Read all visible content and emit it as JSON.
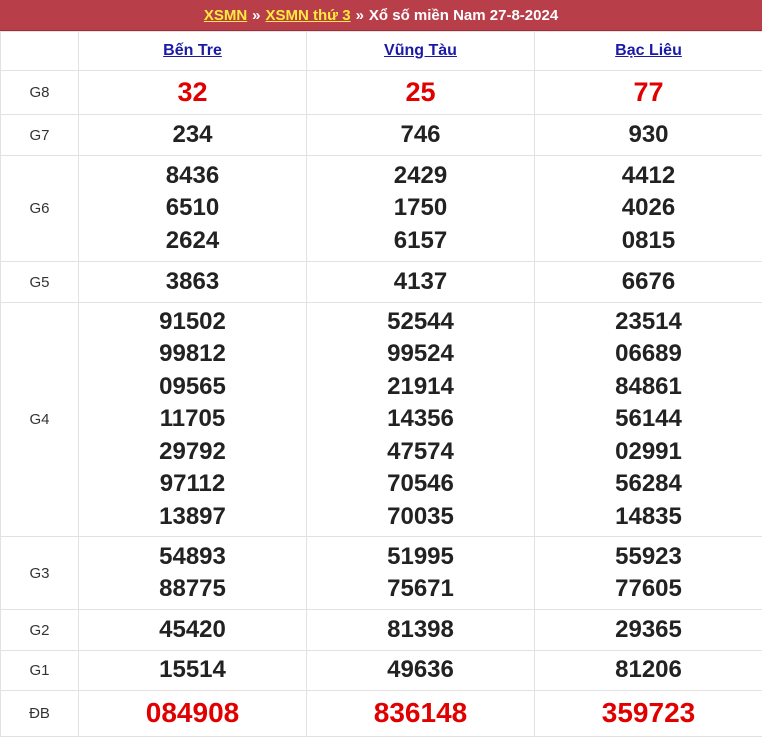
{
  "header": {
    "link1": "XSMN",
    "sep": "»",
    "link2": "XSMN thứ 3",
    "title": "Xổ số miền Nam 27-8-2024"
  },
  "provinces": [
    "Bến Tre",
    "Vũng Tàu",
    "Bạc Liêu"
  ],
  "prizes": {
    "g8": {
      "label": "G8",
      "values": [
        [
          "32"
        ],
        [
          "25"
        ],
        [
          "77"
        ]
      ]
    },
    "g7": {
      "label": "G7",
      "values": [
        [
          "234"
        ],
        [
          "746"
        ],
        [
          "930"
        ]
      ]
    },
    "g6": {
      "label": "G6",
      "values": [
        [
          "8436",
          "6510",
          "2624"
        ],
        [
          "2429",
          "1750",
          "6157"
        ],
        [
          "4412",
          "4026",
          "0815"
        ]
      ]
    },
    "g5": {
      "label": "G5",
      "values": [
        [
          "3863"
        ],
        [
          "4137"
        ],
        [
          "6676"
        ]
      ]
    },
    "g4": {
      "label": "G4",
      "values": [
        [
          "91502",
          "99812",
          "09565",
          "11705",
          "29792",
          "97112",
          "13897"
        ],
        [
          "52544",
          "99524",
          "21914",
          "14356",
          "47574",
          "70546",
          "70035"
        ],
        [
          "23514",
          "06689",
          "84861",
          "56144",
          "02991",
          "56284",
          "14835"
        ]
      ]
    },
    "g3": {
      "label": "G3",
      "values": [
        [
          "54893",
          "88775"
        ],
        [
          "51995",
          "75671"
        ],
        [
          "55923",
          "77605"
        ]
      ]
    },
    "g2": {
      "label": "G2",
      "values": [
        [
          "45420"
        ],
        [
          "81398"
        ],
        [
          "29365"
        ]
      ]
    },
    "g1": {
      "label": "G1",
      "values": [
        [
          "15514"
        ],
        [
          "49636"
        ],
        [
          "81206"
        ]
      ]
    },
    "db": {
      "label": "ĐB",
      "values": [
        [
          "084908"
        ],
        [
          "836148"
        ],
        [
          "359723"
        ]
      ]
    }
  },
  "colors": {
    "header_bg": "#b83f4a",
    "link_yellow": "#ffeb3b",
    "province_blue": "#1a1aa6",
    "prize_red": "#e00000"
  }
}
